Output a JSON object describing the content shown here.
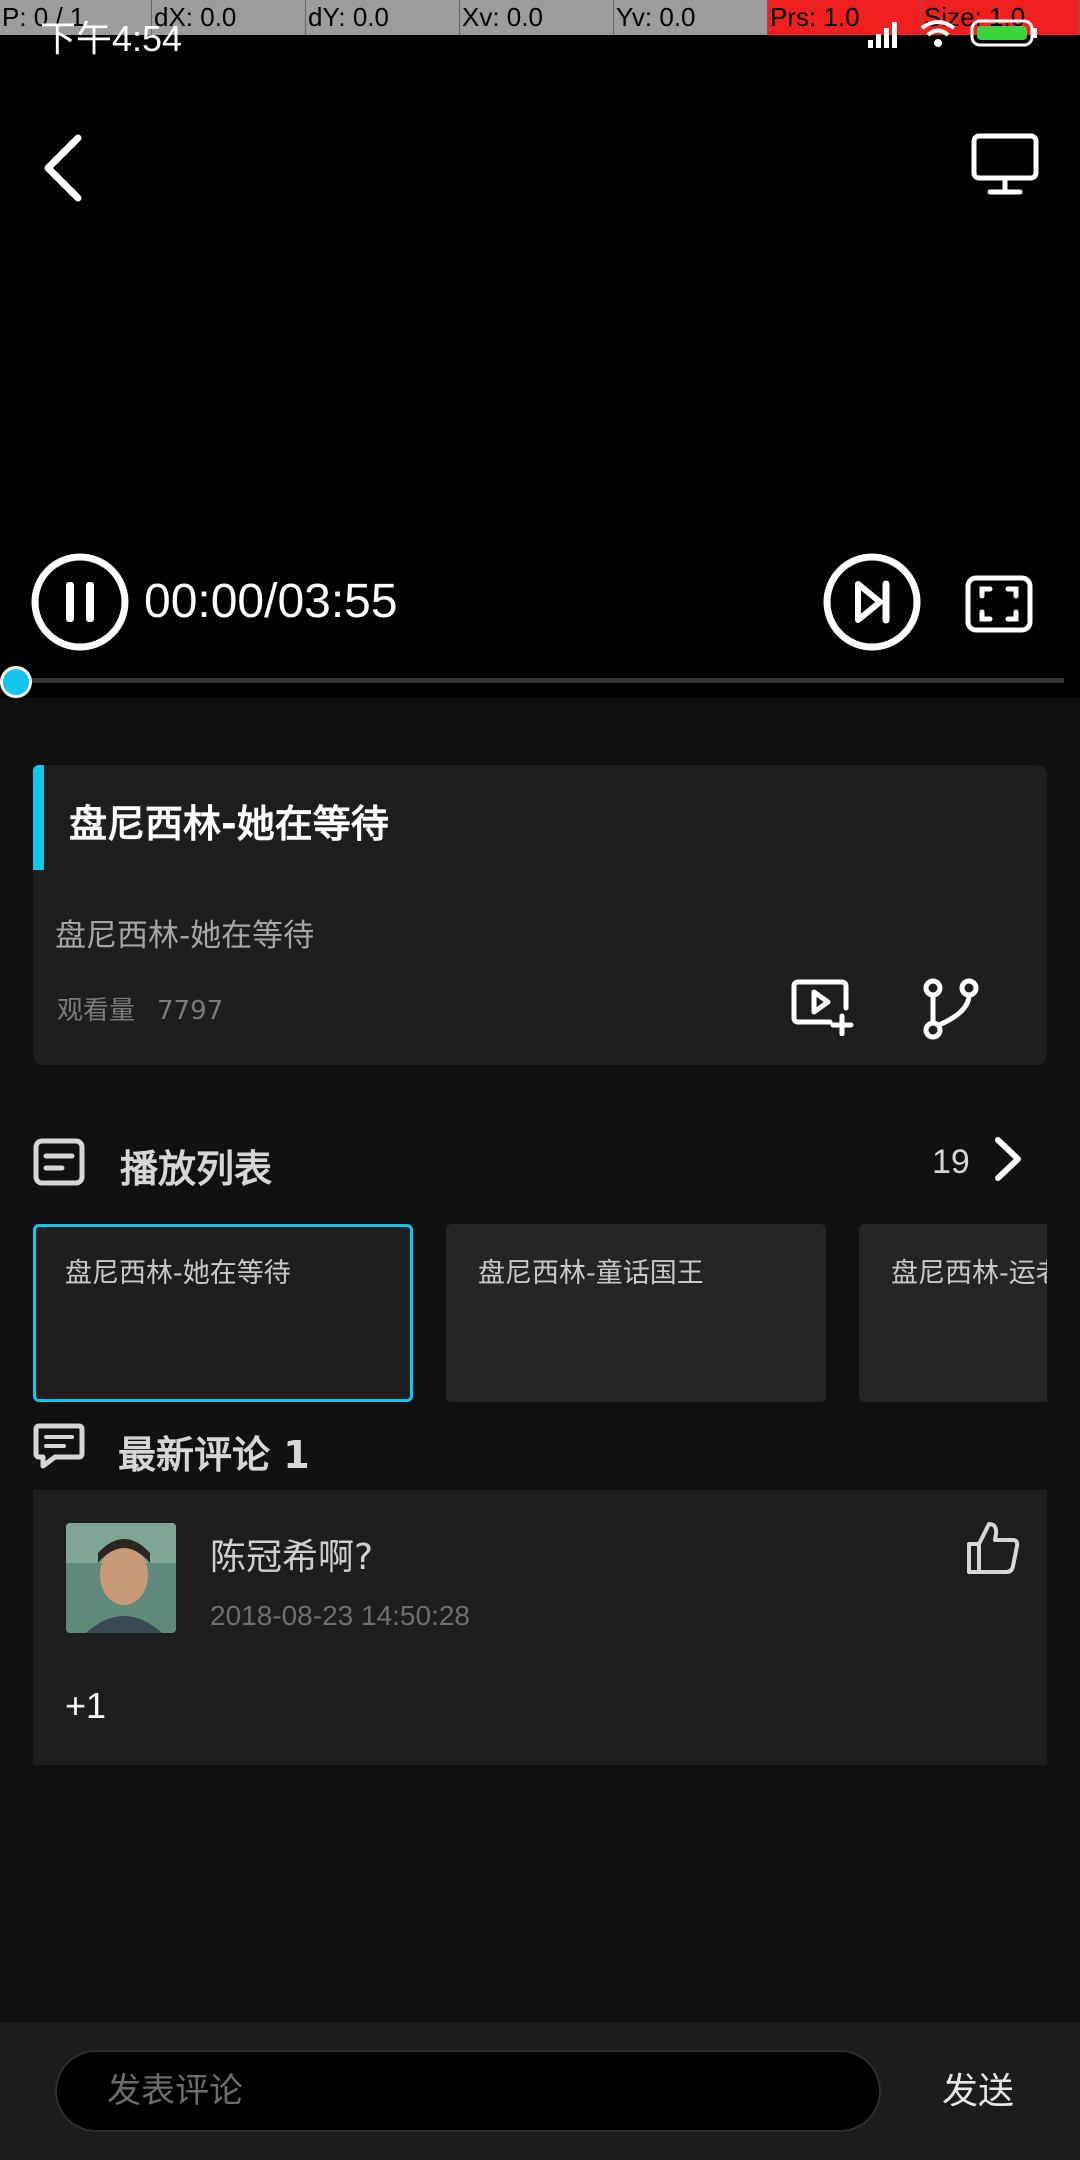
{
  "debug": {
    "cells": [
      {
        "label": "P: 0 / 1",
        "red": false
      },
      {
        "label": "dX: 0.0",
        "red": false
      },
      {
        "label": "dY: 0.0",
        "red": false
      },
      {
        "label": "Xv: 0.0",
        "red": false
      },
      {
        "label": "Yv: 0.0",
        "red": false
      },
      {
        "label": "Prs: 1.0",
        "red": true
      },
      {
        "label": "Size: 1.0",
        "red": true
      }
    ]
  },
  "status": {
    "time": "下午4:54"
  },
  "player": {
    "time_display": "00:00/03:55",
    "progress": 0
  },
  "video_info": {
    "title": "盘尼西林-她在等待",
    "subtitle": "盘尼西林-她在等待",
    "views_label": "观看量",
    "views_count": "7797"
  },
  "playlist": {
    "title": "播放列表",
    "count": "19",
    "items": [
      {
        "label": "盘尼西林-她在等待",
        "active": true
      },
      {
        "label": "盘尼西林-童话国王",
        "active": false
      },
      {
        "label": "盘尼西林-运老枥树",
        "active": false
      }
    ]
  },
  "comments": {
    "title": "最新评论 1",
    "items": [
      {
        "user": "陈冠希啊?",
        "date": "2018-08-23 14:50:28",
        "text": "+1"
      }
    ]
  },
  "composer": {
    "placeholder": "发表评论",
    "send_label": "发送"
  },
  "colors": {
    "accent": "#13c6ee",
    "background": "#111111",
    "card": "#1e1e1f"
  }
}
